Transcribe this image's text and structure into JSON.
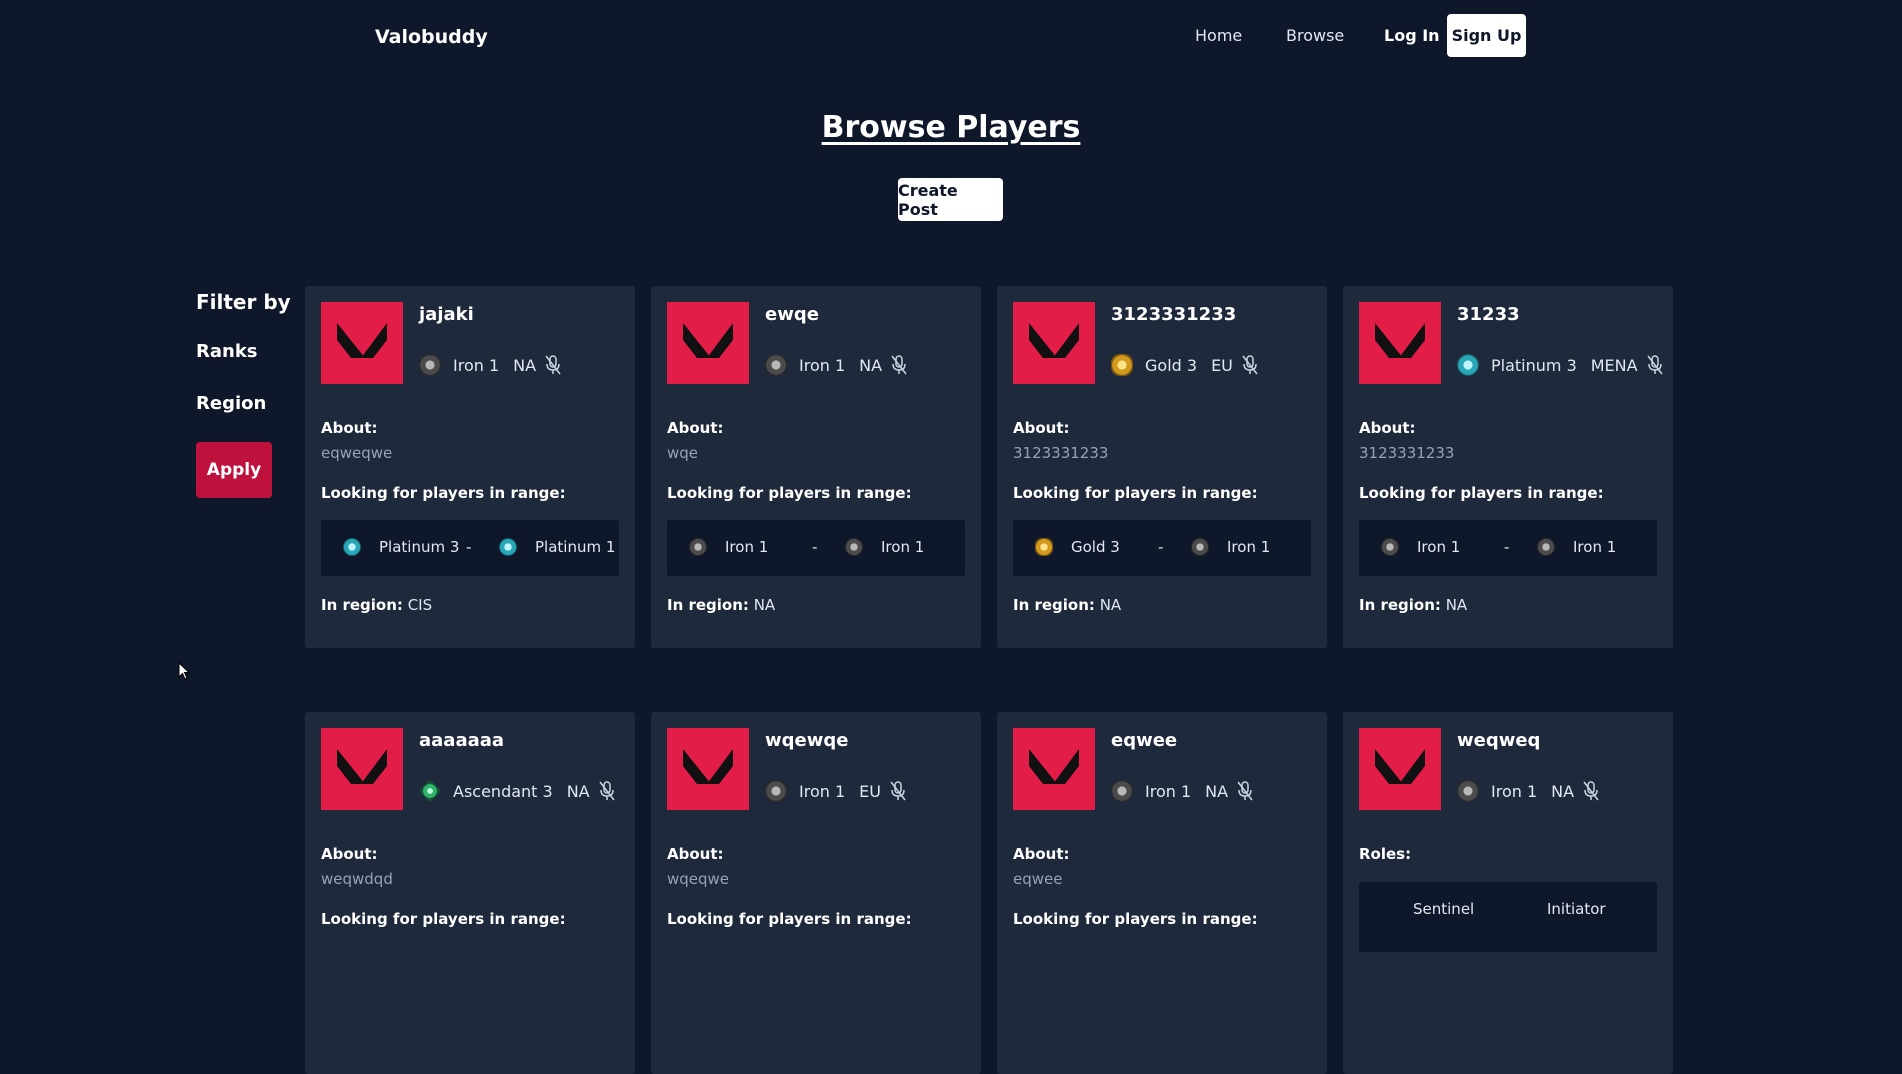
{
  "nav": {
    "brand": "Valobuddy",
    "home": "Home",
    "browse": "Browse",
    "login": "Log In",
    "signup": "Sign Up"
  },
  "page": {
    "title": "Browse Players",
    "create_post": "Create Post"
  },
  "filter": {
    "title": "Filter by",
    "ranks": "Ranks",
    "region": "Region",
    "apply": "Apply"
  },
  "labels": {
    "about": "About:",
    "looking": "Looking for players in range:",
    "in_region": "In region:",
    "roles": "Roles:",
    "dash": "-"
  },
  "colors": {
    "background": "#0f172a",
    "card": "#1e293b",
    "accent": "#e11d48",
    "apply": "#be123c"
  },
  "cards": [
    {
      "name": "jajaki",
      "rank": "Iron 1",
      "rank_icon": "iron",
      "region": "NA",
      "about": "eqweqwe",
      "range_from": "Platinum 3",
      "range_from_icon": "plat",
      "range_to": "Platinum 1",
      "range_to_icon": "plat",
      "in_region": "CIS"
    },
    {
      "name": "ewqe",
      "rank": "Iron 1",
      "rank_icon": "iron",
      "region": "NA",
      "about": "wqe",
      "range_from": "Iron 1",
      "range_from_icon": "iron",
      "range_to": "Iron 1",
      "range_to_icon": "iron",
      "in_region": "NA"
    },
    {
      "name": "3123331233",
      "rank": "Gold 3",
      "rank_icon": "gold",
      "region": "EU",
      "about": "3123331233",
      "range_from": "Gold 3",
      "range_from_icon": "gold",
      "range_to": "Iron 1",
      "range_to_icon": "iron",
      "in_region": "NA"
    },
    {
      "name": "31233",
      "rank": "Platinum 3",
      "rank_icon": "plat",
      "region": "MENA",
      "about": "3123331233",
      "range_from": "Iron 1",
      "range_from_icon": "iron",
      "range_to": "Iron 1",
      "range_to_icon": "iron",
      "in_region": "NA"
    },
    {
      "name": "aaaaaaa",
      "rank": "Ascendant 3",
      "rank_icon": "asc",
      "region": "NA",
      "about": "weqwdqd"
    },
    {
      "name": "wqewqe",
      "rank": "Iron 1",
      "rank_icon": "iron",
      "region": "EU",
      "about": "wqeqwe"
    },
    {
      "name": "eqwee",
      "rank": "Iron 1",
      "rank_icon": "iron",
      "region": "NA",
      "about": "eqwee"
    },
    {
      "name": "weqweq",
      "rank": "Iron 1",
      "rank_icon": "iron",
      "region": "NA",
      "roles": [
        "Sentinel",
        "Initiator"
      ]
    }
  ]
}
